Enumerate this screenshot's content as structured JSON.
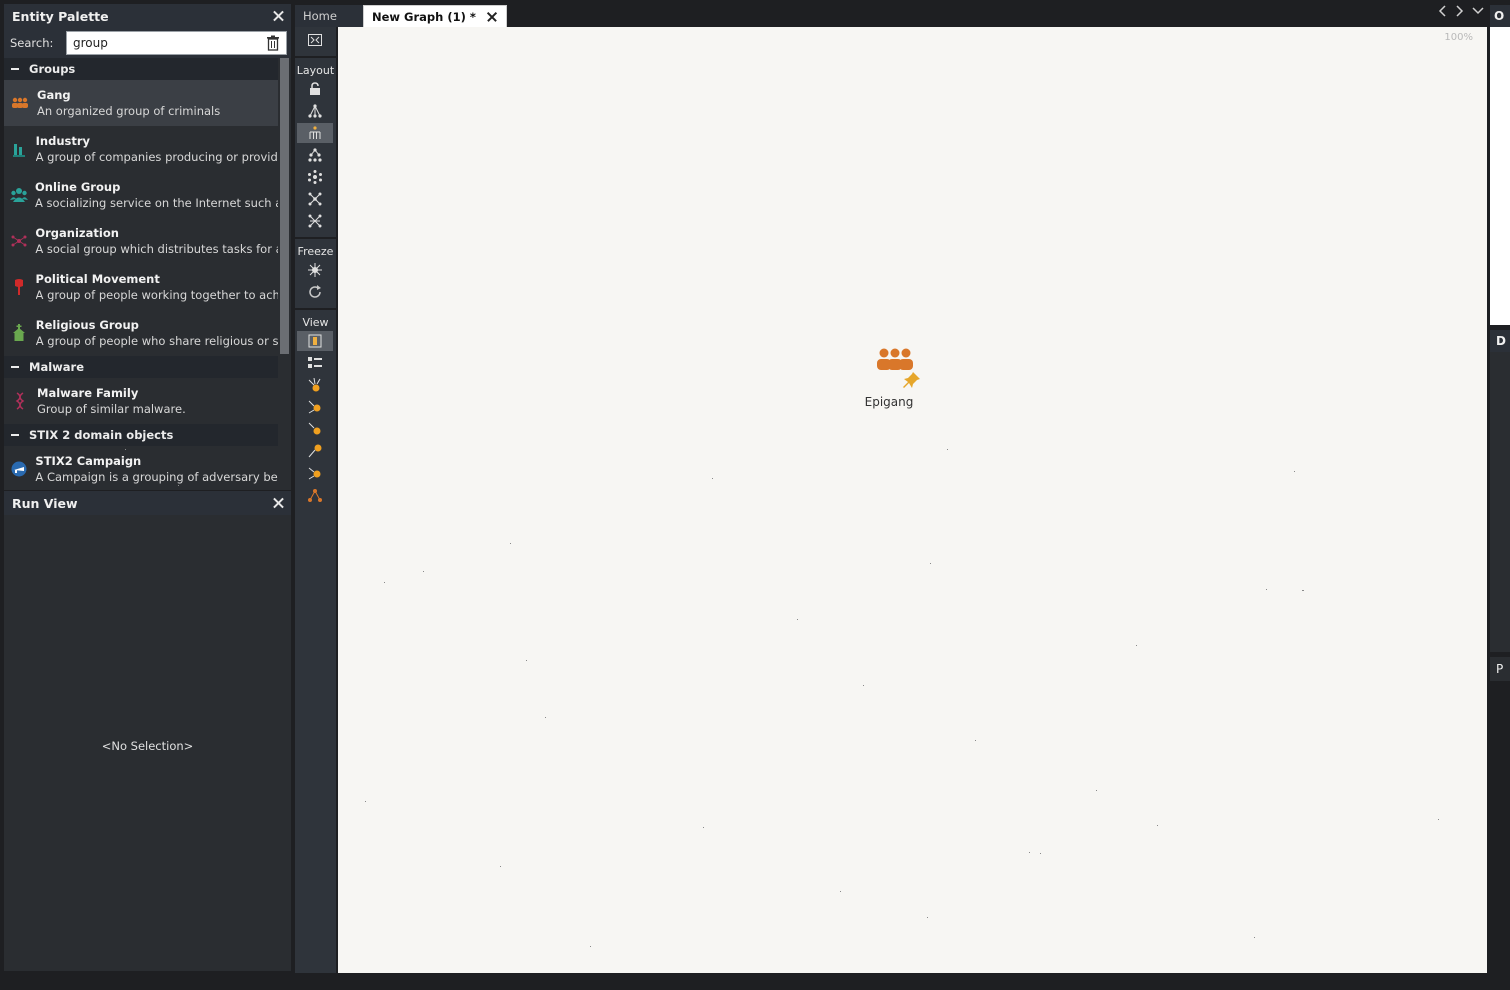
{
  "entity_palette": {
    "title": "Entity Palette",
    "search_label": "Search:",
    "search_value": "group",
    "categories": [
      {
        "label": "Groups",
        "items": [
          {
            "name": "Gang",
            "desc": "An organized group of criminals",
            "icon": "gang-icon",
            "color": "#d9772a",
            "selected": true
          },
          {
            "name": "Industry",
            "desc": "A group of companies producing or providing",
            "icon": "industry-icon",
            "color": "#2aa39a"
          },
          {
            "name": "Online Group",
            "desc": "A socializing service on the Internet such as Fa",
            "icon": "online-group-icon",
            "color": "#2aa39a"
          },
          {
            "name": "Organization",
            "desc": "A social group which distributes tasks for a co",
            "icon": "organization-icon",
            "color": "#b0305a"
          },
          {
            "name": "Political Movement",
            "desc": "A group of people working together to achiev",
            "icon": "political-movement-icon",
            "color": "#d02a2a"
          },
          {
            "name": "Religious Group",
            "desc": "A group of people who share religious or spir",
            "icon": "religious-group-icon",
            "color": "#6aa84f"
          }
        ]
      },
      {
        "label": "Malware",
        "items": [
          {
            "name": "Malware Family",
            "desc": "Group of similar malware.",
            "icon": "malware-family-icon",
            "color": "#b0305a"
          }
        ]
      },
      {
        "label": "STIX 2 domain objects",
        "items": [
          {
            "name": "STIX2 Campaign",
            "desc": "A Campaign is a grouping of adversary behav",
            "icon": "stix2-campaign-icon",
            "color": "#2a6ab0"
          }
        ]
      }
    ]
  },
  "run_view": {
    "title": "Run View",
    "empty_text": "<No Selection>"
  },
  "tabs": [
    {
      "label": "Home",
      "active": false
    },
    {
      "label": "New Graph (1) *",
      "active": true
    }
  ],
  "toolbar": {
    "layout_label": "Layout",
    "freeze_label": "Freeze",
    "view_label": "View"
  },
  "graph": {
    "zoom": "100%",
    "node_label": "Epigang",
    "node_color": "#d9772a"
  },
  "right_panels": {
    "top_title": "O",
    "mid_title": "D",
    "bottom_title": "P"
  }
}
